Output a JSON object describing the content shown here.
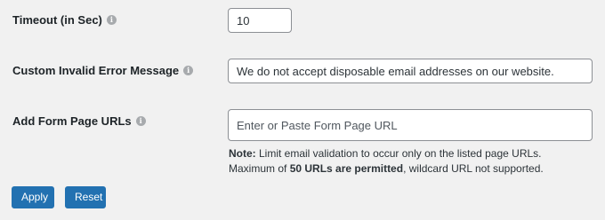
{
  "settings": {
    "timeout": {
      "label": "Timeout (in Sec)",
      "value": "10"
    },
    "error_message": {
      "label": "Custom Invalid Error Message",
      "value": "We do not accept disposable email addresses on our website."
    },
    "form_urls": {
      "label": "Add Form Page URLs",
      "value": "",
      "placeholder": "Enter or Paste Form Page URL",
      "note": {
        "prefix": "Note:",
        "line1": " Limit email validation to occur only on the listed page URLs.",
        "line2_a": "Maximum of ",
        "line2_bold": "50 URLs are permitted",
        "line2_b": ", wildcard URL not supported."
      }
    }
  },
  "icons": {
    "info": "info-circle-icon"
  },
  "buttons": {
    "apply": "Apply",
    "reset": "Reset"
  },
  "colors": {
    "accent": "#2271b1",
    "background": "#f1f1f1"
  }
}
